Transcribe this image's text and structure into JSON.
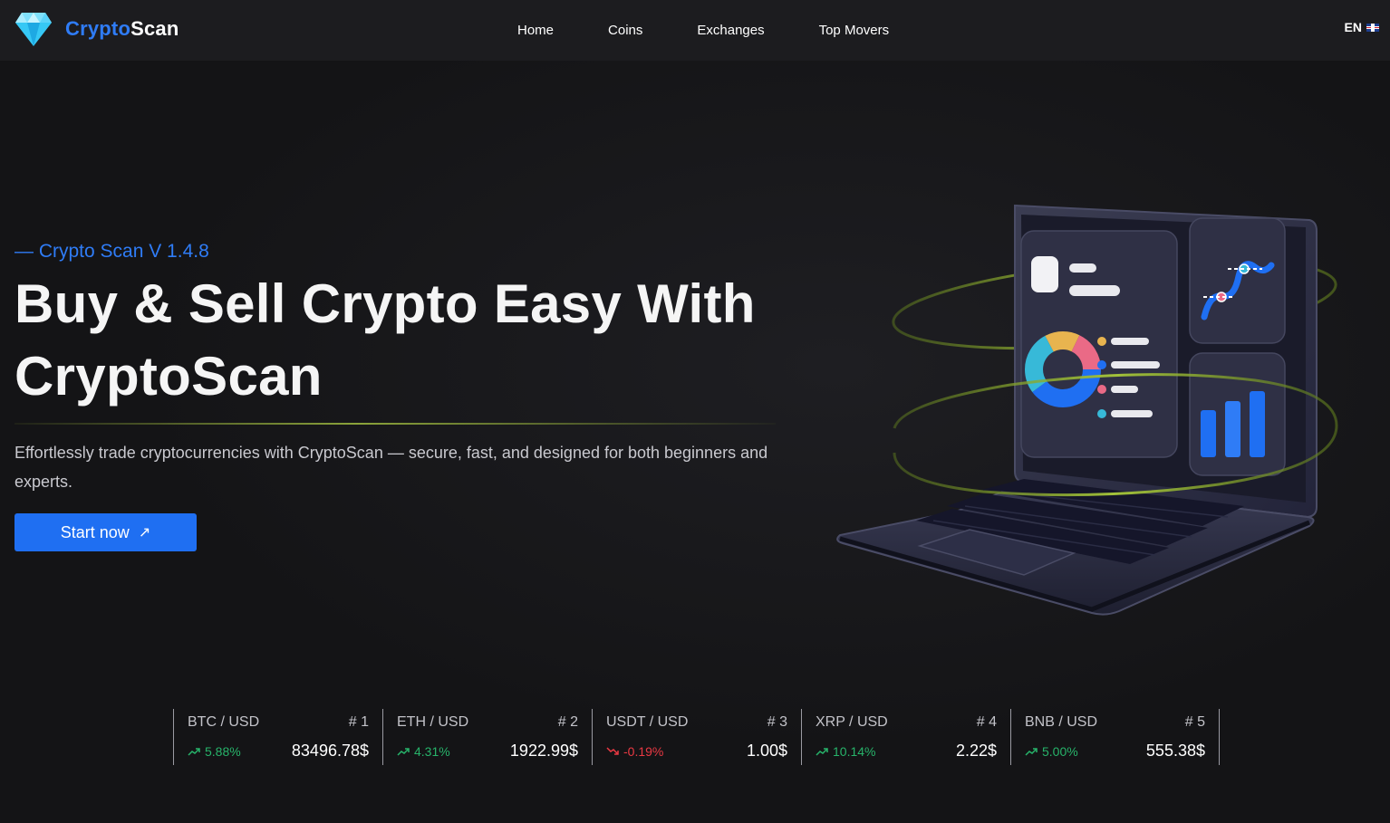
{
  "header": {
    "logo_part1": "Crypto",
    "logo_part2": "Scan",
    "nav": [
      "Home",
      "Coins",
      "Exchanges",
      "Top Movers"
    ],
    "language": "EN"
  },
  "hero": {
    "version": "— Crypto Scan V 1.4.8",
    "headline_line1": "Buy & Sell Crypto Easy With",
    "headline_line2": "CryptoScan",
    "description": "Effortlessly trade cryptocurrencies with CryptoScan — secure, fast, and designed for both beginners and experts.",
    "cta_label": "Start now",
    "cta_icon": "↗"
  },
  "ticker": [
    {
      "pair": "BTC / USD",
      "rank": "# 1",
      "change": "5.88%",
      "direction": "up",
      "price": "83496.78$"
    },
    {
      "pair": "ETH / USD",
      "rank": "# 2",
      "change": "4.31%",
      "direction": "up",
      "price": "1922.99$"
    },
    {
      "pair": "USDT / USD",
      "rank": "# 3",
      "change": "-0.19%",
      "direction": "down",
      "price": "1.00$"
    },
    {
      "pair": "XRP / USD",
      "rank": "# 4",
      "change": "10.14%",
      "direction": "up",
      "price": "2.22$"
    },
    {
      "pair": "BNB / USD",
      "rank": "# 5",
      "change": "5.00%",
      "direction": "up",
      "price": "555.38$"
    }
  ],
  "colors": {
    "accent": "#2f7cf6",
    "button": "#1f6ff2",
    "up": "#27b36a",
    "down": "#ea3943",
    "background": "#141416",
    "header": "#1c1c1f"
  },
  "icons": {
    "logo": "diamond-icon",
    "flag": "uk-flag-icon",
    "trend_up": "trend-up-icon",
    "trend_down": "trend-down-icon",
    "cta_arrow": "arrow-up-right-icon"
  }
}
